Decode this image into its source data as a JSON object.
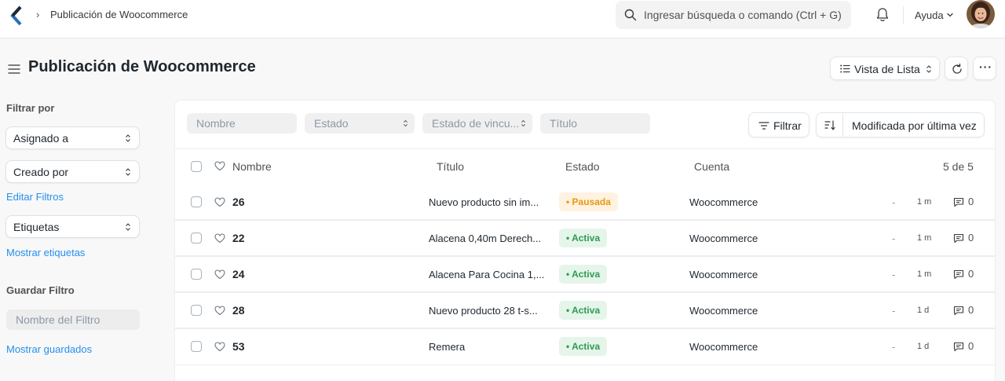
{
  "navbar": {
    "breadcrumb_separator": "›",
    "breadcrumb": "Publicación de Woocommerce",
    "search_placeholder": "Ingresar búsqueda o comando (Ctrl + G)",
    "help_label": "Ayuda",
    "logo_color": "#2c6eb5"
  },
  "page": {
    "title": "Publicación de Woocommerce",
    "view_label": "Vista de Lista",
    "more_label": "···"
  },
  "sidebar": {
    "filter_heading": "Filtrar por",
    "filters": [
      "Asignado a",
      "Creado por"
    ],
    "edit_filters": "Editar Filtros",
    "tags": "Etiquetas",
    "show_tags": "Mostrar etiquetas",
    "save_filter_heading": "Guardar Filtro",
    "filter_name_placeholder": "Nombre del Filtro",
    "show_saved": "Mostrar guardados"
  },
  "filters_bar": {
    "name": "Nombre",
    "status": "Estado",
    "link_status": "Estado de vincu...",
    "title": "Título",
    "filter_button": "Filtrar",
    "sort_label": "Modificada por última vez"
  },
  "table": {
    "columns": [
      "Nombre",
      "Título",
      "Estado",
      "Cuenta"
    ],
    "count": "5 de 5",
    "rows": [
      {
        "name": "26",
        "title": "Nuevo producto sin im...",
        "status": "Pausada",
        "status_type": "paused",
        "account": "Woocommerce",
        "dash": "-",
        "modified": "1 m",
        "comments": "0"
      },
      {
        "name": "22",
        "title": "Alacena 0,40m Derech...",
        "status": "Activa",
        "status_type": "active",
        "account": "Woocommerce",
        "dash": "-",
        "modified": "1 m",
        "comments": "0"
      },
      {
        "name": "24",
        "title": "Alacena Para Cocina 1,...",
        "status": "Activa",
        "status_type": "active",
        "account": "Woocommerce",
        "dash": "-",
        "modified": "1 m",
        "comments": "0"
      },
      {
        "name": "28",
        "title": "Nuevo producto 28 t-s...",
        "status": "Activa",
        "status_type": "active",
        "account": "Woocommerce",
        "dash": "-",
        "modified": "1 d",
        "comments": "0"
      },
      {
        "name": "53",
        "title": "Remera",
        "status": "Activa",
        "status_type": "active",
        "account": "Woocommerce",
        "dash": "-",
        "modified": "1 d",
        "comments": "0"
      }
    ]
  },
  "colors": {
    "link": "#2490ef",
    "paused_bg": "#fff2e0",
    "paused_text": "#e79913",
    "active_bg": "#e5f5ea",
    "active_text": "#2f9b52"
  }
}
